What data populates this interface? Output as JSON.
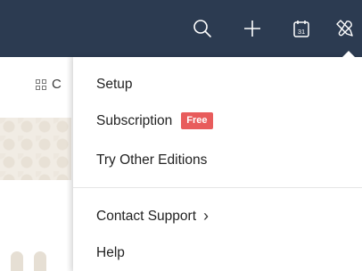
{
  "topbar": {
    "background": "#2c3b51",
    "icons": {
      "search": "search-icon",
      "add": "plus-icon",
      "calendar": "calendar-icon",
      "calendar_day": "31",
      "tools": "tools-icon"
    }
  },
  "left_panel": {
    "tab_label": "C",
    "tab_icon": "grid-icon"
  },
  "menu": {
    "setup_label": "Setup",
    "subscription_label": "Subscription",
    "subscription_badge": "Free",
    "try_editions_label": "Try Other Editions",
    "contact_label": "Contact Support",
    "contact_chevron": "›",
    "help_label": "Help",
    "badge_color": "#e85c5c"
  }
}
